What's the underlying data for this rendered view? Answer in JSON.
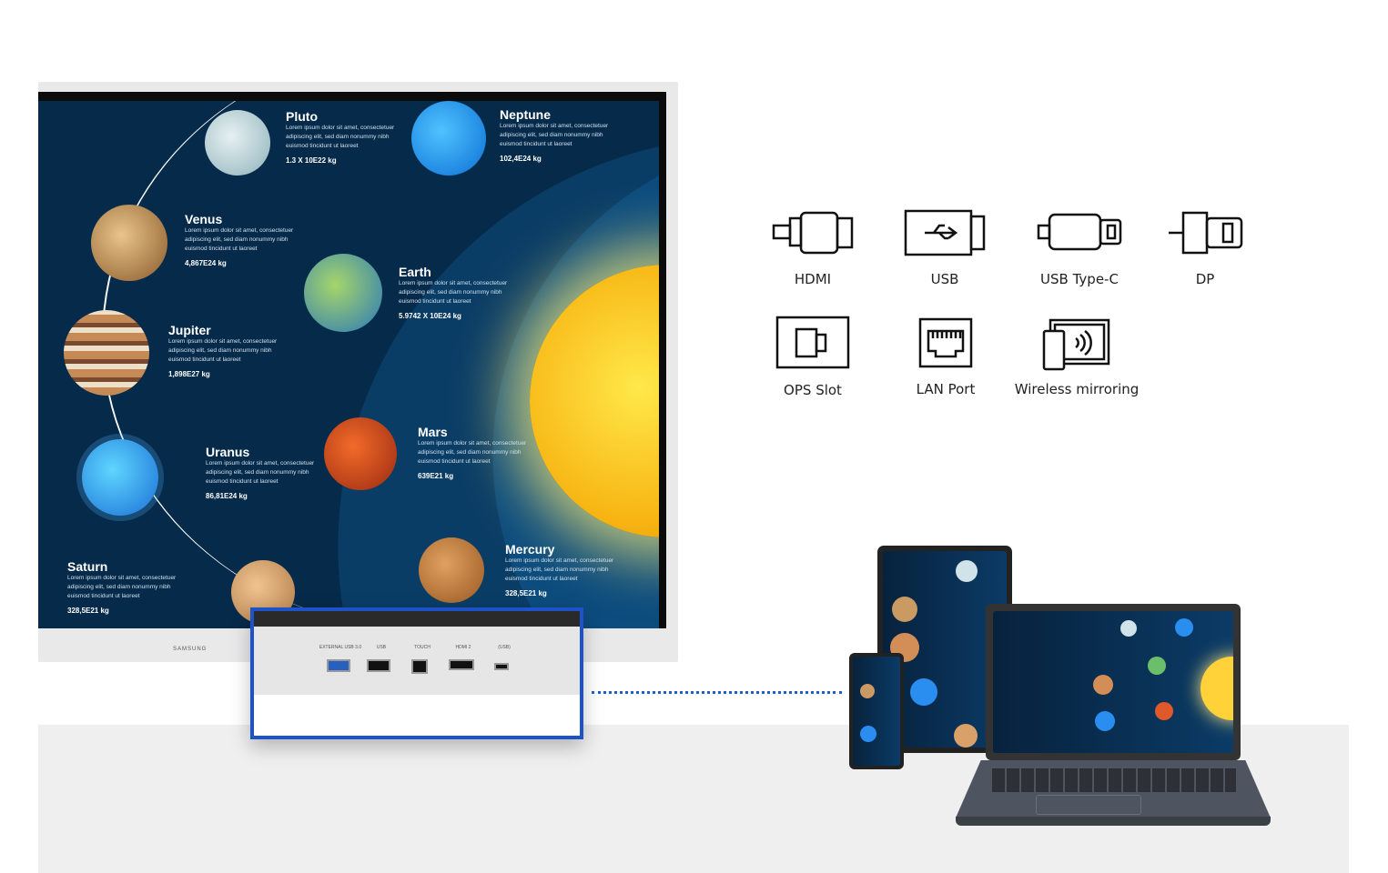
{
  "screen": {
    "brand": "SAMSUNG",
    "planets": [
      {
        "name": "Pluto",
        "desc": "Lorem ipsum dolor sit amet, consectetuer adipiscing elit, sed diam nonummy nibh euismod tincidunt ut laoreet",
        "mass": "1.3 X 10E22 kg"
      },
      {
        "name": "Neptune",
        "desc": "Lorem ipsum dolor sit amet, consectetuer adipiscing elit, sed diam nonummy nibh euismod tincidunt ut laoreet",
        "mass": "102,4E24 kg"
      },
      {
        "name": "Venus",
        "desc": "Lorem ipsum dolor sit amet, consectetuer adipiscing elit, sed diam nonummy nibh euismod tincidunt ut laoreet",
        "mass": "4,867E24 kg"
      },
      {
        "name": "Earth",
        "desc": "Lorem ipsum dolor sit amet, consectetuer adipiscing elit, sed diam nonummy nibh euismod tincidunt ut laoreet",
        "mass": "5.9742 X 10E24 kg"
      },
      {
        "name": "Jupiter",
        "desc": "Lorem ipsum dolor sit amet, consectetuer adipiscing elit, sed diam nonummy nibh euismod tincidunt ut laoreet",
        "mass": "1,898E27 kg"
      },
      {
        "name": "Mars",
        "desc": "Lorem ipsum dolor sit amet, consectetuer adipiscing elit, sed diam nonummy nibh euismod tincidunt ut laoreet",
        "mass": "639E21 kg"
      },
      {
        "name": "Uranus",
        "desc": "Lorem ipsum dolor sit amet, consectetuer adipiscing elit, sed diam nonummy nibh euismod tincidunt ut laoreet",
        "mass": "86,81E24 kg"
      },
      {
        "name": "Mercury",
        "desc": "Lorem ipsum dolor sit amet, consectetuer adipiscing elit, sed diam nonummy nibh euismod tincidunt ut laoreet",
        "mass": "328,5E21 kg"
      },
      {
        "name": "Saturn",
        "desc": "Lorem ipsum dolor sit amet, consectetuer adipiscing elit, sed diam nonummy nibh euismod tincidunt ut laoreet",
        "mass": "328,5E21 kg"
      }
    ]
  },
  "ports_panel": {
    "labels": [
      "EXTERNAL USB 3.0",
      "USB",
      "TOUCH",
      "HDMI 2",
      "(USB)"
    ],
    "accent": "#1d52c8"
  },
  "connectivity": [
    {
      "label": "HDMI",
      "icon": "hdmi-icon"
    },
    {
      "label": "USB",
      "icon": "usb-icon"
    },
    {
      "label": "USB Type-C",
      "icon": "usb-c-icon"
    },
    {
      "label": "DP",
      "icon": "displayport-icon"
    },
    {
      "label": "OPS Slot",
      "icon": "ops-slot-icon"
    },
    {
      "label": "LAN Port",
      "icon": "lan-port-icon"
    },
    {
      "label": "Wireless mirroring",
      "icon": "wireless-mirroring-icon"
    }
  ]
}
